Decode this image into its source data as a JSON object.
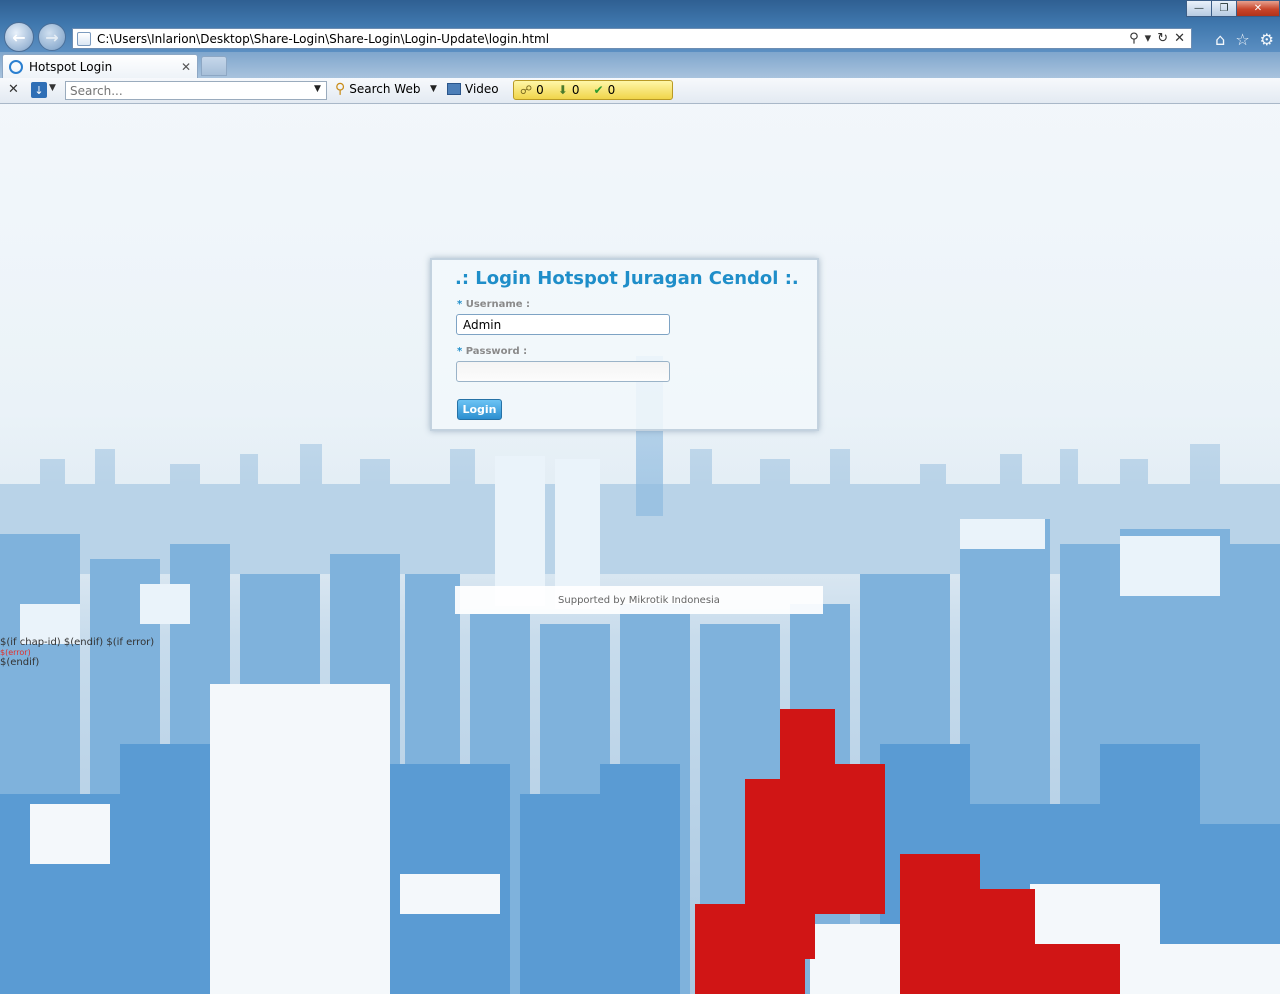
{
  "browser": {
    "address": "C:\\Users\\Inlarion\\Desktop\\Share-Login\\Share-Login\\Login-Update\\login.html",
    "tab_title": "Hotspot Login"
  },
  "toolbar": {
    "search_placeholder": "Search...",
    "search_web_label": "Search Web",
    "video_label": "Video",
    "counters": [
      "0",
      "0",
      "0"
    ]
  },
  "login": {
    "title": ".: Login Hotspot Juragan Cendol :.",
    "username_label": "Username :",
    "username_value": "Admin",
    "password_label": "Password :",
    "required_mark": "*",
    "button_label": "Login"
  },
  "footer": {
    "text": "Supported by Mikrotik Indonesia"
  },
  "template_text": {
    "line1": "$(if chap-id) $(endif) $(if error)",
    "line2": "$(error)",
    "line3": "$(endif)"
  },
  "colors": {
    "accent": "#1f8ec9",
    "sky": "#e8f1f7",
    "building_blue": "#4f93cf",
    "building_red": "#d01515"
  }
}
